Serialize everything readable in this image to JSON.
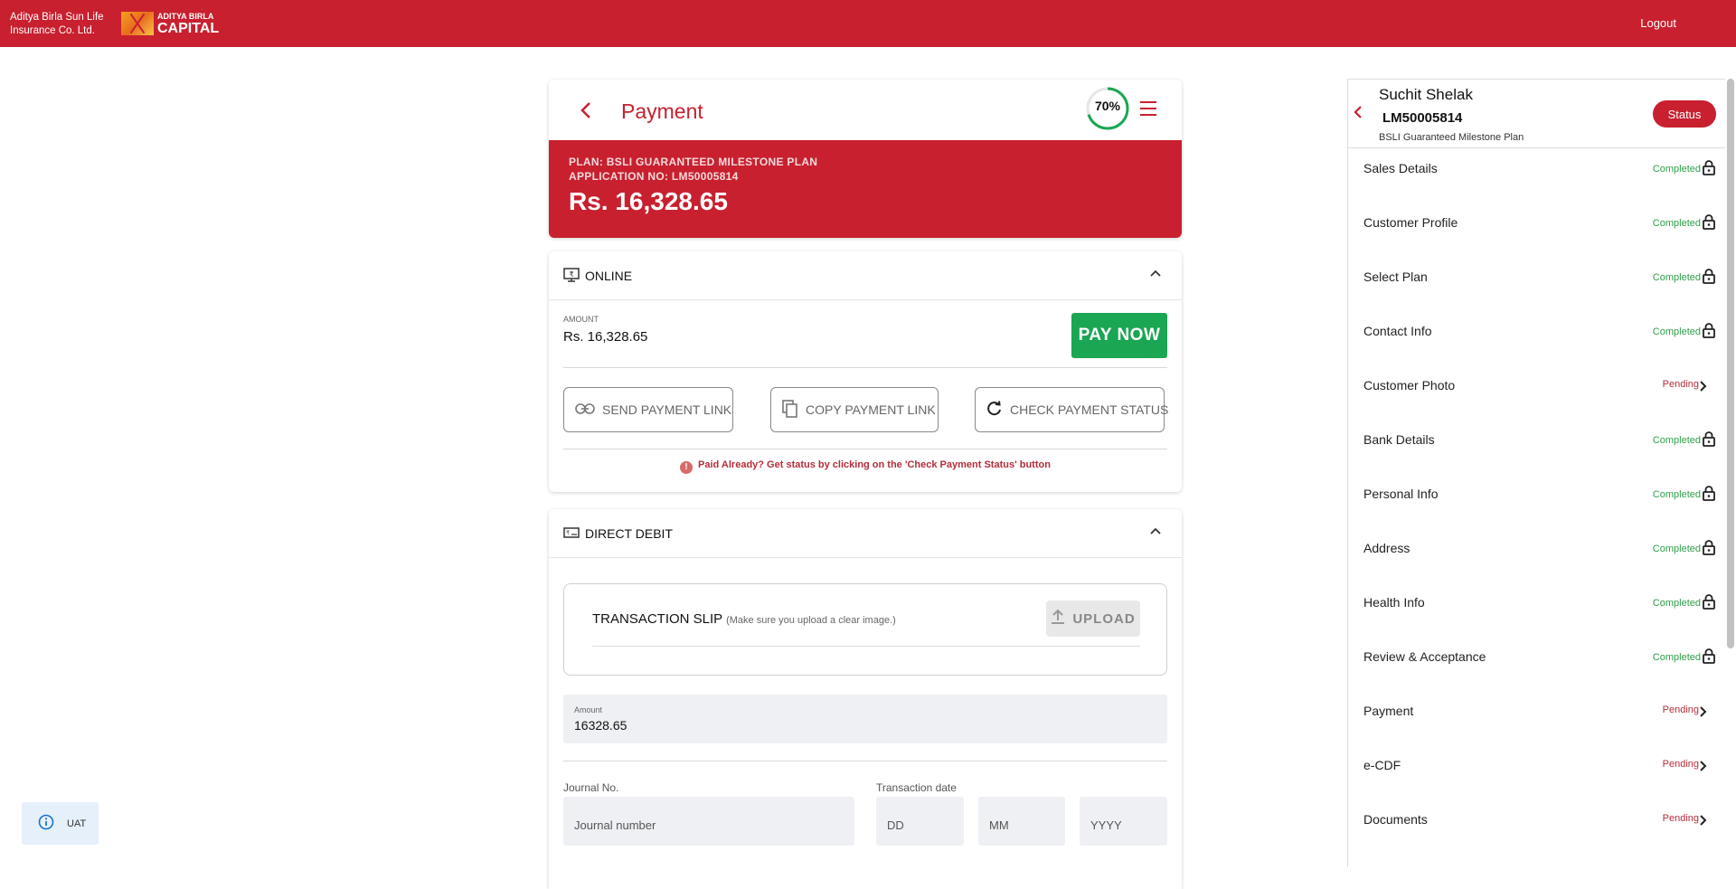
{
  "topbar": {
    "company_line1": "Aditya Birla Sun Life",
    "company_line2": "Insurance Co. Ltd.",
    "logo_line1": "ADITYA BIRLA",
    "logo_line2": "CAPITAL",
    "logout_label": "Logout",
    "bg_color": "#c8202f"
  },
  "header": {
    "title": "Payment",
    "progress_text": "70%",
    "progress_value": 0.7,
    "plan_line": "PLAN: BSLI GUARANTEED MILESTONE PLAN",
    "application_line": "APPLICATION NO: LM50005814",
    "amount": "Rs. 16,328.65"
  },
  "online": {
    "label": "ONLINE",
    "amount_label": "AMOUNT",
    "amount_value": "Rs. 16,328.65",
    "pay_now_label": "PAY NOW",
    "send_link_label": "SEND PAYMENT LINK",
    "copy_link_label": "COPY PAYMENT LINK",
    "check_status_label": "CHECK PAYMENT STATUS",
    "note": "Paid Already? Get status by clicking on the 'Check Payment Status' button",
    "pay_color": "#1aa653"
  },
  "direct_debit": {
    "label": "DIRECT DEBIT",
    "slip_title": "TRANSACTION SLIP",
    "slip_subtitle": "(Make sure you upload a clear image.)",
    "upload_label": "UPLOAD",
    "amount_label": "Amount",
    "amount_value": "16328.65",
    "journal_label": "Journal No.",
    "journal_placeholder": "Journal number",
    "date_label": "Transaction date",
    "dd_placeholder": "DD",
    "mm_placeholder": "MM",
    "yyyy_placeholder": "YYYY"
  },
  "side": {
    "customer_name": "Suchit Shelak",
    "application_no": "LM50005814",
    "plan_name": "BSLI Guaranteed Milestone Plan",
    "status_label": "Status",
    "items": [
      {
        "label": "Sales Details",
        "status": "Completed",
        "icon": "lock-icon"
      },
      {
        "label": "Customer Profile",
        "status": "Completed",
        "icon": "lock-icon"
      },
      {
        "label": "Select Plan",
        "status": "Completed",
        "icon": "lock-icon"
      },
      {
        "label": "Contact Info",
        "status": "Completed",
        "icon": "lock-icon"
      },
      {
        "label": "Customer Photo",
        "status": "Pending",
        "icon": "chevron-right-icon"
      },
      {
        "label": "Bank Details",
        "status": "Completed",
        "icon": "lock-icon"
      },
      {
        "label": "Personal Info",
        "status": "Completed",
        "icon": "lock-icon"
      },
      {
        "label": "Address",
        "status": "Completed",
        "icon": "lock-icon"
      },
      {
        "label": "Health Info",
        "status": "Completed",
        "icon": "lock-icon"
      },
      {
        "label": "Review & Acceptance",
        "status": "Completed",
        "icon": "lock-icon"
      },
      {
        "label": "Payment",
        "status": "Pending",
        "icon": "chevron-right-icon"
      },
      {
        "label": "e-CDF",
        "status": "Pending",
        "icon": "chevron-right-icon"
      },
      {
        "label": "Documents",
        "status": "Pending",
        "icon": "chevron-right-icon"
      }
    ]
  },
  "env_badge": {
    "label": "UAT"
  }
}
